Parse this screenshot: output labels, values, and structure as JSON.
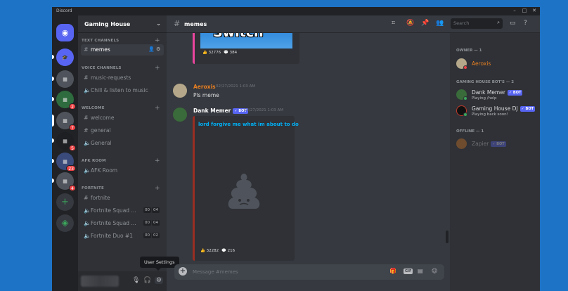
{
  "app": {
    "title": "Discord"
  },
  "servers": [
    {
      "name": "home",
      "icon": "discord-logo-icon"
    },
    {
      "name": "graduation-cap-server",
      "icon": "graduation-cap-icon"
    },
    {
      "name": "server-2",
      "badge": ""
    },
    {
      "name": "server-3",
      "badge": "2"
    },
    {
      "name": "gaming-house-server",
      "badge": "7"
    },
    {
      "name": "server-5",
      "badge": "5"
    },
    {
      "name": "server-6",
      "badge": "23"
    },
    {
      "name": "server-7",
      "badge": "4"
    }
  ],
  "sidebar": {
    "server_name": "Gaming House",
    "categories": {
      "text": "TEXT CHANNELS",
      "voice": "VOICE CHANNELS",
      "welcome": "WELCOME",
      "afk": "AFK ROOM",
      "fortnite": "FORTNITE"
    },
    "channels": {
      "memes": "memes",
      "music_requests": "music-requests",
      "chill": "Chill & listen to music",
      "welcome": "welcome",
      "general_text": "general",
      "general_voice": "General",
      "afk": "AFK Room",
      "fortnite": "fortnite",
      "squad1": "Fortnite Squad ...",
      "squad1_count": "00",
      "squad1_limit": "04",
      "squad2": "Fortnite Squad ...",
      "squad2_count": "00",
      "squad2_limit": "04",
      "duo": "Fortnite Duo #1",
      "duo_count": "00",
      "duo_limit": "02"
    }
  },
  "tooltip": "User Settings",
  "header": {
    "channel": "memes",
    "search_placeholder": "Search"
  },
  "messages": [
    {
      "reactions": [
        "32776",
        "384"
      ]
    },
    {
      "author": "Aeroxis",
      "time": "02/27/2021 1:03 AM",
      "text": "Pls meme",
      "author_color": "#e67e22"
    },
    {
      "author": "Dank Memer",
      "bot": "✓ BOT",
      "time": "02/27/2021 1:03 AM",
      "embed_title": "lord forgive me what im about to do",
      "reactions": [
        "32282",
        "216"
      ]
    }
  ],
  "meme_image_text": "Switch",
  "composer": {
    "placeholder": "Message #memes",
    "gif": "GIF"
  },
  "members": {
    "owner_cat": "OWNER — 1",
    "owner": {
      "name": "Aeroxis",
      "color": "#e67e22"
    },
    "bots_cat": "GAMING HOUSE BOT'S — 2",
    "bots": [
      {
        "name": "Dank Memer",
        "badge": "✓ BOT",
        "status": "Playing /help"
      },
      {
        "name": "Gaming House DJ",
        "badge": "✓ BOT",
        "status": "Playing back soon!"
      }
    ],
    "offline_cat": "OFFLINE — 1",
    "offline": [
      {
        "name": "Zapier",
        "badge": "✓ BOT"
      }
    ]
  },
  "colors": {
    "blurple": "#5865f2",
    "background": "#36393f",
    "sidebar": "#2f3136",
    "rail": "#202225"
  }
}
